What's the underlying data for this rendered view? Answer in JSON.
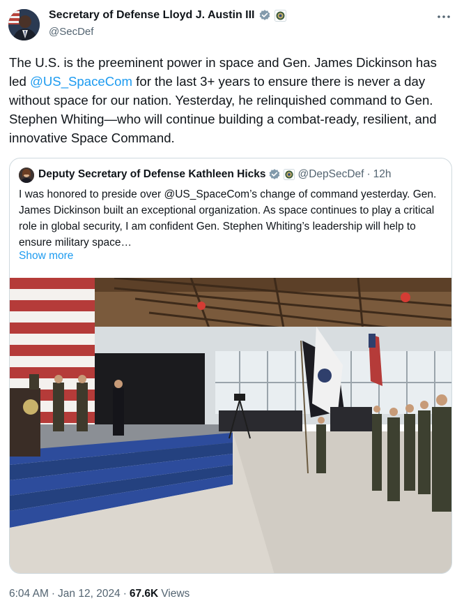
{
  "author": {
    "name": "Secretary of Defense Lloyd J. Austin III",
    "handle": "@SecDef",
    "verified_color": "#829aab"
  },
  "tweet": {
    "text_before_mention": "The U.S. is the preeminent power in space and Gen. James Dickinson has led ",
    "mention": "@US_SpaceCom",
    "text_after_mention": " for the last 3+ years to ensure there is never a day without space for our nation. Yesterday, he relinquished command to Gen. Stephen Whiting—who will continue building a combat-ready, resilient, and innovative Space Command."
  },
  "quoted": {
    "name": "Deputy Secretary of Defense Kathleen Hicks",
    "handle": "@DepSecDef",
    "separator": "·",
    "time": "12h",
    "text": "I was honored to preside over @US_SpaceCom’s change of command yesterday. Gen. James Dickinson built an exceptional organization. As space continues to play a critical role in global security, I am confident Gen. Stephen Whiting’s leadership will help to ensure military space…",
    "show_more": "Show more"
  },
  "footer": {
    "time": "6:04 AM",
    "separator": "·",
    "date": "Jan 12, 2024",
    "separator2": "·",
    "views_count": "67.6K",
    "views_label": "Views"
  },
  "icons": {
    "verified": "verified-badge-icon",
    "affiliate": "dod-seal-icon",
    "more": "more-horizontal-icon"
  },
  "colors": {
    "link": "#1d9bf0",
    "secondary_text": "#536471",
    "border": "#cfd9de"
  }
}
